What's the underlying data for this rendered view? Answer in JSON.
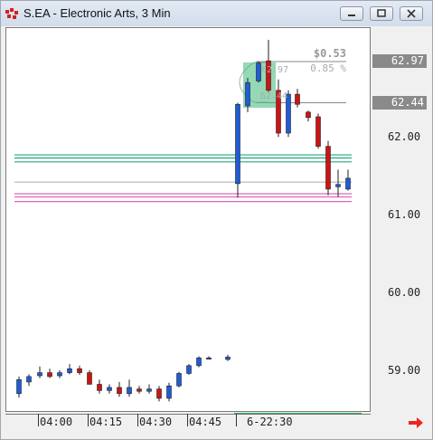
{
  "window": {
    "title": "S.EA - Electronic Arts, 3 Min",
    "buttons": [
      "minimize",
      "maximize",
      "close"
    ]
  },
  "colors": {
    "up": "#1f5cd6",
    "down": "#cc1414",
    "green_line": "#22aa77",
    "pink_line": "#dd66bb",
    "gray_line": "#888888",
    "arrow": "#ee2222"
  },
  "annotation": {
    "change": "$0.53",
    "percent": "0.85 %",
    "high_label": "62.97",
    "low_label": "62.44"
  },
  "price_tags": [
    "62.97",
    "62.44"
  ],
  "chart_data": {
    "type": "candlestick",
    "y_ticks": [
      62.0,
      61.0,
      60.0,
      59.0
    ],
    "y_tick_labels": [
      "62.00",
      "61.00",
      "60.00",
      "59.00"
    ],
    "ylim": [
      58.45,
      63.42
    ],
    "x_tick_labels": [
      "04:00",
      "04:15",
      "04:30",
      "04:45",
      "6-22:30"
    ],
    "horizontal_lines": {
      "green": [
        61.77,
        61.73,
        61.68
      ],
      "pink": [
        61.27,
        61.23,
        61.17
      ],
      "gray": [
        61.42,
        62.44,
        62.97
      ]
    },
    "candles": [
      {
        "o": 58.7,
        "h": 58.92,
        "l": 58.65,
        "c": 58.88
      },
      {
        "o": 58.85,
        "h": 58.95,
        "l": 58.8,
        "c": 58.92
      },
      {
        "o": 58.93,
        "h": 59.05,
        "l": 58.9,
        "c": 58.97
      },
      {
        "o": 58.97,
        "h": 59.02,
        "l": 58.9,
        "c": 58.92
      },
      {
        "o": 58.93,
        "h": 59.0,
        "l": 58.9,
        "c": 58.97
      },
      {
        "o": 58.97,
        "h": 59.08,
        "l": 58.95,
        "c": 59.02
      },
      {
        "o": 59.02,
        "h": 59.06,
        "l": 58.94,
        "c": 58.97
      },
      {
        "o": 58.97,
        "h": 59.0,
        "l": 58.84,
        "c": 58.82
      },
      {
        "o": 58.82,
        "h": 58.88,
        "l": 58.7,
        "c": 58.74
      },
      {
        "o": 58.74,
        "h": 58.82,
        "l": 58.7,
        "c": 58.78
      },
      {
        "o": 58.78,
        "h": 58.85,
        "l": 58.66,
        "c": 58.7
      },
      {
        "o": 58.7,
        "h": 58.88,
        "l": 58.66,
        "c": 58.78
      },
      {
        "o": 58.76,
        "h": 58.8,
        "l": 58.7,
        "c": 58.73
      },
      {
        "o": 58.73,
        "h": 58.82,
        "l": 58.7,
        "c": 58.76
      },
      {
        "o": 58.76,
        "h": 58.8,
        "l": 58.6,
        "c": 58.64
      },
      {
        "o": 58.64,
        "h": 58.84,
        "l": 58.6,
        "c": 58.8
      },
      {
        "o": 58.8,
        "h": 58.98,
        "l": 58.78,
        "c": 58.96
      },
      {
        "o": 58.96,
        "h": 59.08,
        "l": 58.94,
        "c": 59.06
      },
      {
        "o": 59.06,
        "h": 59.18,
        "l": 59.04,
        "c": 59.16
      },
      {
        "o": 59.16,
        "h": 59.18,
        "l": 59.14,
        "c": 59.16
      },
      {
        "o": 59.14,
        "h": 59.2,
        "l": 59.12,
        "c": 59.17
      },
      {
        "o": 61.4,
        "h": 62.44,
        "l": 61.22,
        "c": 62.42
      },
      {
        "o": 62.4,
        "h": 62.76,
        "l": 62.32,
        "c": 62.7
      },
      {
        "o": 62.72,
        "h": 62.97,
        "l": 62.7,
        "c": 62.95
      },
      {
        "o": 62.98,
        "h": 63.25,
        "l": 62.58,
        "c": 62.6
      },
      {
        "o": 62.6,
        "h": 62.74,
        "l": 62.0,
        "c": 62.05
      },
      {
        "o": 62.05,
        "h": 62.6,
        "l": 62.0,
        "c": 62.55
      },
      {
        "o": 62.55,
        "h": 62.62,
        "l": 62.38,
        "c": 62.42
      },
      {
        "o": 62.32,
        "h": 62.34,
        "l": 62.2,
        "c": 62.25
      },
      {
        "o": 62.26,
        "h": 62.3,
        "l": 61.85,
        "c": 61.88
      },
      {
        "o": 61.88,
        "h": 61.95,
        "l": 61.25,
        "c": 61.33
      },
      {
        "o": 61.36,
        "h": 61.58,
        "l": 61.23,
        "c": 61.39
      },
      {
        "o": 61.33,
        "h": 61.58,
        "l": 61.31,
        "c": 61.47
      }
    ]
  }
}
